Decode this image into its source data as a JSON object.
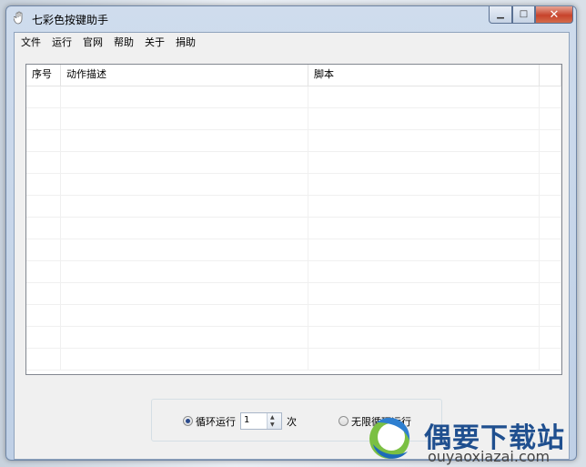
{
  "window": {
    "title": "七彩色按键助手"
  },
  "menu": [
    "文件",
    "运行",
    "官网",
    "帮助",
    "关于",
    "捐助"
  ],
  "table": {
    "columns": [
      "序号",
      "动作描述",
      "脚本",
      ""
    ],
    "rows": []
  },
  "loop": {
    "count_label": "循环运行",
    "count_value": "1",
    "count_unit": "次",
    "infinite_label": "无限循环运行",
    "selected": "count"
  },
  "watermark": {
    "brand": "偶要下载站",
    "url": "ouyaoxiazai.com"
  },
  "colors": {
    "accent": "#1f4f8f",
    "close_button": "#c7432b"
  }
}
